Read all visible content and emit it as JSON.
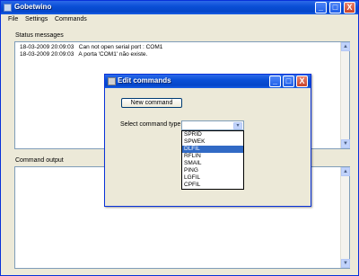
{
  "window": {
    "title": "Gobetwino",
    "caption_buttons": {
      "minimize": "_",
      "maximize": "□",
      "close": "X"
    }
  },
  "menu": [
    {
      "label": "File"
    },
    {
      "label": "Settings"
    },
    {
      "label": "Commands"
    }
  ],
  "status_panel": {
    "label": "Status messages",
    "lines": [
      "18-03-2009 20:09:03   Can not open serial port : COM1",
      "18-03-2009 20:09:03   A porta 'COM1' não existe."
    ]
  },
  "output_panel": {
    "label": "Command output"
  },
  "dialog": {
    "title": "Edit commands",
    "new_command_button": "New command",
    "select_label": "Select command type",
    "select_value": "",
    "options": [
      "SPRID",
      "SPWEK",
      "DLFIL",
      "RFLIN",
      "SMAIL",
      "PING",
      "LGFIL",
      "CPFIL"
    ],
    "selected_option": "DLFIL"
  },
  "icons": {
    "scroll_up": "▲",
    "scroll_down": "▼",
    "combo_arrow": "▾"
  }
}
